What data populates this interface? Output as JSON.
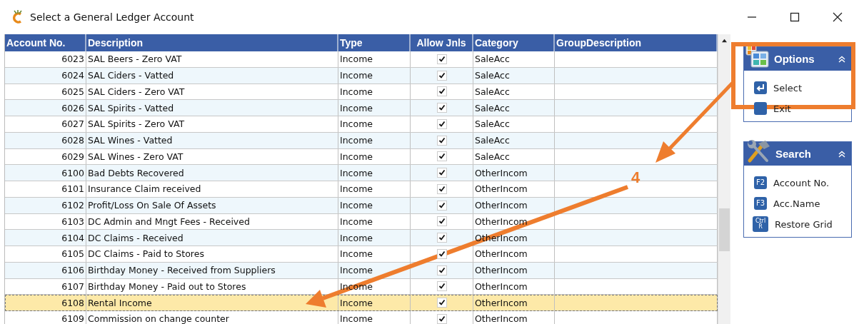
{
  "window": {
    "title": "Select a General Ledger Account"
  },
  "table": {
    "columns": [
      "Account No.",
      "Description",
      "Type",
      "Allow Jnls",
      "Category",
      "GroupDescription"
    ],
    "rows": [
      {
        "account": "6023",
        "description": "SAL Beers - Zero VAT",
        "type": "Income",
        "allow_jnls": true,
        "category": "SaleAcc",
        "selected": false
      },
      {
        "account": "6024",
        "description": "SAL Ciders - Vatted",
        "type": "Income",
        "allow_jnls": true,
        "category": "SaleAcc",
        "selected": false
      },
      {
        "account": "6025",
        "description": "SAL Ciders - Zero VAT",
        "type": "Income",
        "allow_jnls": true,
        "category": "SaleAcc",
        "selected": false
      },
      {
        "account": "6026",
        "description": "SAL Spirits - Vatted",
        "type": "Income",
        "allow_jnls": true,
        "category": "SaleAcc",
        "selected": false
      },
      {
        "account": "6027",
        "description": "SAL Spirits - Zero VAT",
        "type": "Income",
        "allow_jnls": true,
        "category": "SaleAcc",
        "selected": false
      },
      {
        "account": "6028",
        "description": "SAL Wines - Vatted",
        "type": "Income",
        "allow_jnls": true,
        "category": "SaleAcc",
        "selected": false
      },
      {
        "account": "6029",
        "description": "SAL Wines - Zero VAT",
        "type": "Income",
        "allow_jnls": true,
        "category": "SaleAcc",
        "selected": false
      },
      {
        "account": "6100",
        "description": "Bad Debts Recovered",
        "type": "Income",
        "allow_jnls": true,
        "category": "OtherIncom",
        "selected": false
      },
      {
        "account": "6101",
        "description": "Insurance Claim received",
        "type": "Income",
        "allow_jnls": true,
        "category": "OtherIncom",
        "selected": false
      },
      {
        "account": "6102",
        "description": "Profit/Loss On Sale Of Assets",
        "type": "Income",
        "allow_jnls": true,
        "category": "OtherIncom",
        "selected": false
      },
      {
        "account": "6103",
        "description": "DC Admin and Mngt Fees - Received",
        "type": "Income",
        "allow_jnls": true,
        "category": "OtherIncom",
        "selected": false
      },
      {
        "account": "6104",
        "description": "DC Claims - Received",
        "type": "Income",
        "allow_jnls": true,
        "category": "OtherIncom",
        "selected": false
      },
      {
        "account": "6105",
        "description": "DC Claims - Paid to Stores",
        "type": "Income",
        "allow_jnls": true,
        "category": "OtherIncom",
        "selected": false
      },
      {
        "account": "6106",
        "description": "Birthday Money - Received from Suppliers",
        "type": "Income",
        "allow_jnls": true,
        "category": "OtherIncom",
        "selected": false
      },
      {
        "account": "6107",
        "description": "Birthday Money - Paid out to Stores",
        "type": "Income",
        "allow_jnls": true,
        "category": "OtherIncom",
        "selected": false
      },
      {
        "account": "6108",
        "description": "Rental Income",
        "type": "Income",
        "allow_jnls": true,
        "category": "OtherIncom",
        "selected": true
      },
      {
        "account": "6109",
        "description": "Commission on change counter",
        "type": "Income",
        "allow_jnls": true,
        "category": "OtherIncom",
        "selected": false
      }
    ]
  },
  "panels": [
    {
      "title": "Options",
      "kind": "options",
      "items": [
        {
          "label": "Select",
          "kind": "enter"
        },
        {
          "label": "Exit",
          "kind": "esc"
        }
      ]
    },
    {
      "title": "Search",
      "kind": "tools",
      "items": [
        {
          "label": "Account No.",
          "key": "F2"
        },
        {
          "label": "Acc.Name",
          "key": "F3"
        },
        {
          "label": "Restore Grid",
          "key": "Ctrl R"
        }
      ]
    }
  ],
  "annotation": {
    "step": "4"
  }
}
